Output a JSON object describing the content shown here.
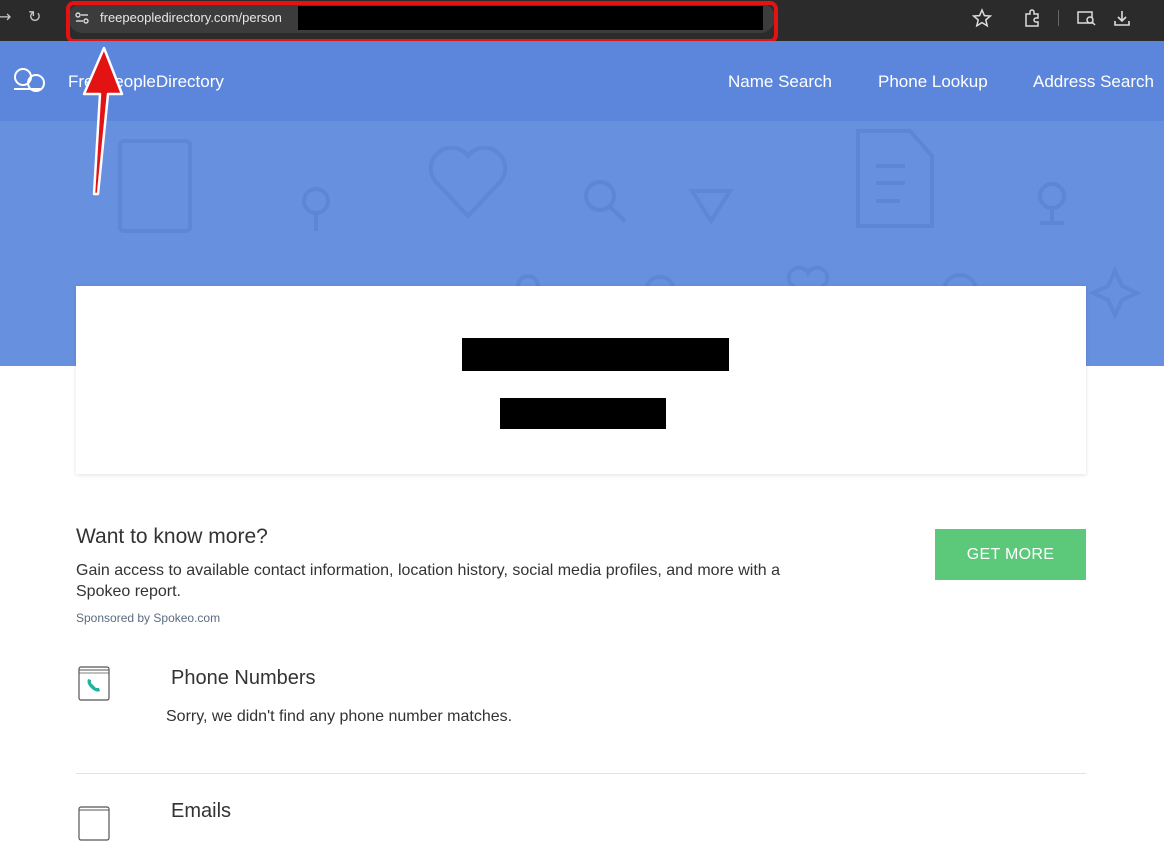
{
  "browser": {
    "url_visible": "freepeopledirectory.com/person",
    "icons": [
      "back-icon",
      "reload-icon",
      "site-info-icon",
      "star-icon",
      "extensions-icon",
      "reading-mode-icon",
      "download-icon"
    ]
  },
  "site": {
    "brand": "FreePeopleDirectory",
    "nav": [
      "Name Search",
      "Phone Lookup",
      "Address Search"
    ],
    "accent_color": "#5b86dc",
    "hero_color": "#6790df"
  },
  "promo": {
    "title": "Want to know more?",
    "body": "Gain access to available contact information, location history, social media profiles, and more with a Spokeo report.",
    "sponsor": "Sponsored by Spokeo.com",
    "button": "GET MORE",
    "button_color": "#5cc97a"
  },
  "sections": [
    {
      "title": "Phone Numbers",
      "body": "Sorry, we didn't find any phone number matches."
    },
    {
      "title": "Emails"
    }
  ],
  "annotation": {
    "highlight_color": "#e31313"
  }
}
